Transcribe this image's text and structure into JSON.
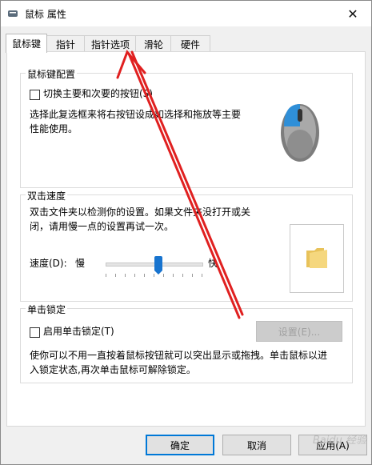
{
  "window": {
    "title": "鼠标 属性",
    "close_glyph": "✕"
  },
  "tabs": [
    {
      "label": "鼠标键",
      "active": true
    },
    {
      "label": "指针",
      "active": false
    },
    {
      "label": "指针选项",
      "active": false
    },
    {
      "label": "滑轮",
      "active": false
    },
    {
      "label": "硬件",
      "active": false
    }
  ],
  "button_config": {
    "title": "鼠标键配置",
    "swap_label": "切换主要和次要的按钮(S)",
    "description_line1": "选择此复选框来将右按钮设成如选择和拖放等主要",
    "description_line2": "性能使用。",
    "mouse_icon": "mouse-icon",
    "accent_color": "#2f8fd8"
  },
  "double_click": {
    "title": "双击速度",
    "description_line1": "双击文件夹以检测你的设置。如果文件夹没打开或关",
    "description_line2": "闭，请用慢一点的设置再试一次。",
    "speed_label": "速度(D):",
    "slow_label": "慢",
    "fast_label": "快",
    "speed_level": 0.55,
    "folder_icon": "folder-icon"
  },
  "click_lock": {
    "title": "单击锁定",
    "enable_label": "启用单击锁定(T)",
    "settings_label": "设置(E)...",
    "description_line1": "使你可以不用一直按着鼠标按钮就可以突出显示或拖拽。单击鼠标以进",
    "description_line2": "入锁定状态,再次单击鼠标可解除锁定。"
  },
  "footer": {
    "ok_label": "确定",
    "cancel_label": "取消",
    "apply_label": "应用(A)"
  },
  "watermark": "Baidu 经验",
  "annotation_color": "#e02020"
}
